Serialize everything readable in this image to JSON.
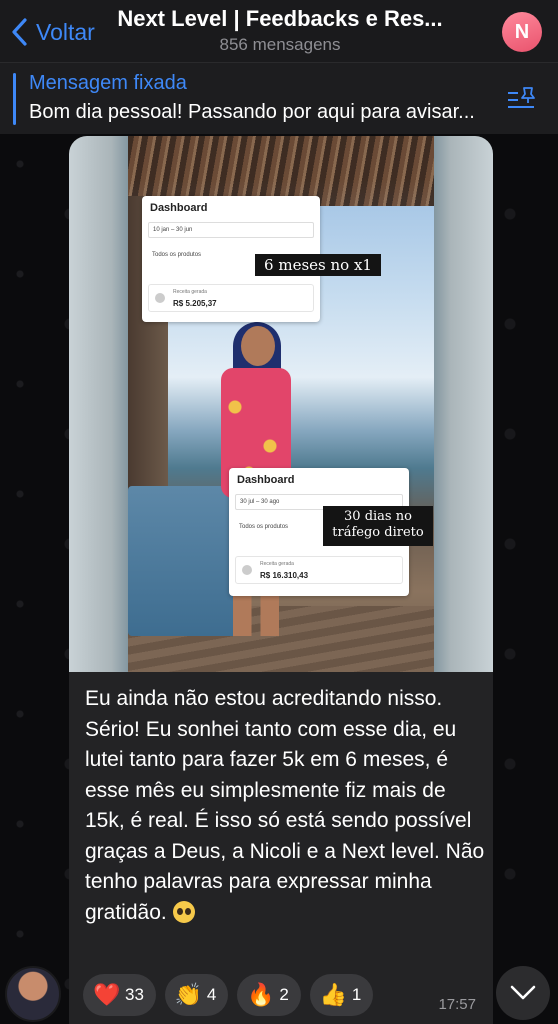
{
  "header": {
    "back_label": "Voltar",
    "title": "Next Level | Feedbacks e Res...",
    "subtitle": "856 mensagens",
    "avatar_letter": "N",
    "avatar_color": "#e9536d"
  },
  "pinned": {
    "label": "Mensagem fixada",
    "text": "Bom dia pessoal! Passando por aqui para avisar..."
  },
  "message": {
    "photo": {
      "dashboard1": {
        "title": "Dashboard",
        "period": "10 jan – 30 jun",
        "products": "Todos os produtos",
        "revenue_label": "Receita gerada",
        "revenue_value": "R$ 5.205,37",
        "caption": "6 meses no x1"
      },
      "dashboard2": {
        "title": "Dashboard",
        "period": "30 jul – 30 ago",
        "products": "Todos os produtos",
        "revenue_label": "Receita gerada",
        "revenue_value": "R$ 16.310,43",
        "caption_line1": "30 dias no",
        "caption_line2": "tráfego direto"
      }
    },
    "text": "Eu ainda não estou acreditando nisso. Sério! Eu sonhei tanto com esse dia, eu lutei tanto para fazer 5k em 6 meses, é esse mês eu simplesmente fiz mais de 15k, é real. É isso só está sendo possível graças a Deus, a Nicoli e a Next level. Não tenho palavras para expressar minha gratidão.",
    "emoji": "pleading-face",
    "time": "17:57",
    "reactions": [
      {
        "icon": "❤️",
        "name": "heart",
        "count": "33"
      },
      {
        "icon": "👏",
        "name": "clap",
        "count": "4"
      },
      {
        "icon": "🔥",
        "name": "fire",
        "count": "2"
      },
      {
        "icon": "👍",
        "name": "thumbs-up",
        "count": "1"
      }
    ]
  },
  "colors": {
    "accent": "#3e88f7",
    "header_bg": "#1a1a1c",
    "bubble_bg": "#232325"
  }
}
